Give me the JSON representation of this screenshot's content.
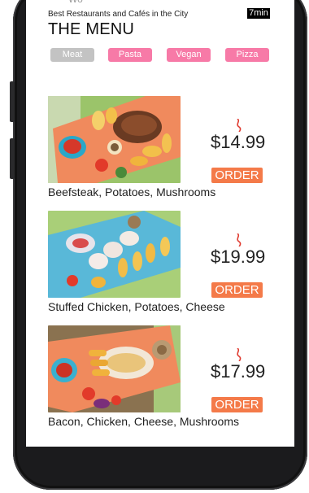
{
  "app": {
    "subtitle": "Best Restaurants and Cafés in the City",
    "title": "THE MENU",
    "time_badge": "7min",
    "clipped_top_text": "Wo"
  },
  "tabs": [
    {
      "label": "Meat",
      "active": true
    },
    {
      "label": "Pasta",
      "active": false
    },
    {
      "label": "Vegan",
      "active": false
    },
    {
      "label": "Pizza",
      "active": false
    }
  ],
  "menu": {
    "order_label": "ORDER",
    "items": [
      {
        "name": "Beefsteak, Potatoes, Mushrooms",
        "price": "$14.99",
        "icon": "spicy-icon"
      },
      {
        "name": "Stuffed Chicken, Potatoes, Cheese",
        "price": "$19.99",
        "icon": "spicy-icon"
      },
      {
        "name": "Bacon, Chicken, Cheese, Mushrooms",
        "price": "$17.99",
        "icon": "spicy-icon"
      }
    ]
  },
  "colors": {
    "accent_pink": "#f77aa7",
    "accent_orange": "#f47a49",
    "inactive_tab": "#c3c3c3",
    "spicy_red": "#e03a2f",
    "device_frame": "#1b1b1d"
  }
}
